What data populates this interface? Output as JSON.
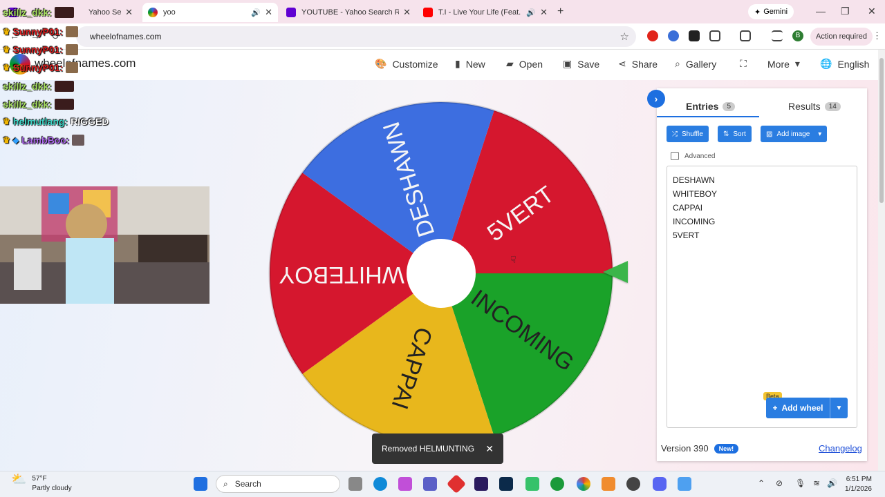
{
  "browser": {
    "tabs": [
      {
        "title": "Yahoo Searc",
        "active": false
      },
      {
        "title": "yoo",
        "active": true
      },
      {
        "title": "YOUTUBE - Yahoo Search Resul",
        "active": false
      },
      {
        "title": "T.I - Live Your Life (Feat. Rih",
        "active": false
      }
    ],
    "gemini_label": "Gemini",
    "url": "wheelofnames.com",
    "action_required": "Action required",
    "profile_initial": "B"
  },
  "site": {
    "brand": "wheelofnames.com",
    "menu": [
      {
        "label": "Customize",
        "icon": "palette-icon"
      },
      {
        "label": "New",
        "icon": "file-icon"
      },
      {
        "label": "Open",
        "icon": "folder-icon"
      },
      {
        "label": "Save",
        "icon": "save-icon"
      },
      {
        "label": "Share",
        "icon": "share-icon"
      },
      {
        "label": "Gallery",
        "icon": "search-icon"
      },
      {
        "label": "",
        "icon": "fullscreen-icon"
      },
      {
        "label": "More",
        "icon": "chevron-down-icon"
      },
      {
        "label": "English",
        "icon": "globe-icon"
      }
    ]
  },
  "wheel": {
    "segments": [
      {
        "label": "5VERT",
        "color": "#d5172e"
      },
      {
        "label": "INCOMING",
        "color": "#1aa229"
      },
      {
        "label": "CAPPAI",
        "color": "#e8b71c"
      },
      {
        "label": "WHITEBOY",
        "color": "#d5172e"
      },
      {
        "label": "DESHAWN",
        "color": "#3d6ee0"
      }
    ]
  },
  "panel": {
    "tab_entries": "Entries",
    "entries_count": "5",
    "tab_results": "Results",
    "results_count": "14",
    "shuffle": "Shuffle",
    "sort": "Sort",
    "add_image": "Add image",
    "advanced": "Advanced",
    "entries": [
      "DESHAWN",
      "WHITEBOY",
      "CAPPAI",
      "INCOMING",
      "5VERT"
    ],
    "beta": "Beta",
    "add_wheel": "Add wheel",
    "version": "Version 390",
    "new_badge": "New!",
    "changelog": "Changelog"
  },
  "toast": {
    "message": "Removed HELMUNTING"
  },
  "chat": [
    {
      "user": "skillz_dkk:",
      "color": "#a8e063",
      "message": ""
    },
    {
      "user": "SunnyP01:",
      "color": "#e02020",
      "message": ""
    },
    {
      "user": "SunnyP01:",
      "color": "#e02020",
      "message": ""
    },
    {
      "user": "SunnyP01:",
      "color": "#e02020",
      "message": ""
    },
    {
      "user": "skillz_dkk:",
      "color": "#a8e063",
      "message": ""
    },
    {
      "user": "skillz_dkk:",
      "color": "#a8e063",
      "message": ""
    },
    {
      "user": "helmutlang:",
      "color": "#3fd6c8",
      "message": "RIGGED"
    },
    {
      "user": "LambBoo:",
      "color": "#b06cf0",
      "message": ""
    }
  ],
  "taskbar": {
    "temp": "57°F",
    "weather": "Partly cloudy",
    "search": "Search",
    "time": "6:51 PM",
    "date": "1/1/2026"
  }
}
